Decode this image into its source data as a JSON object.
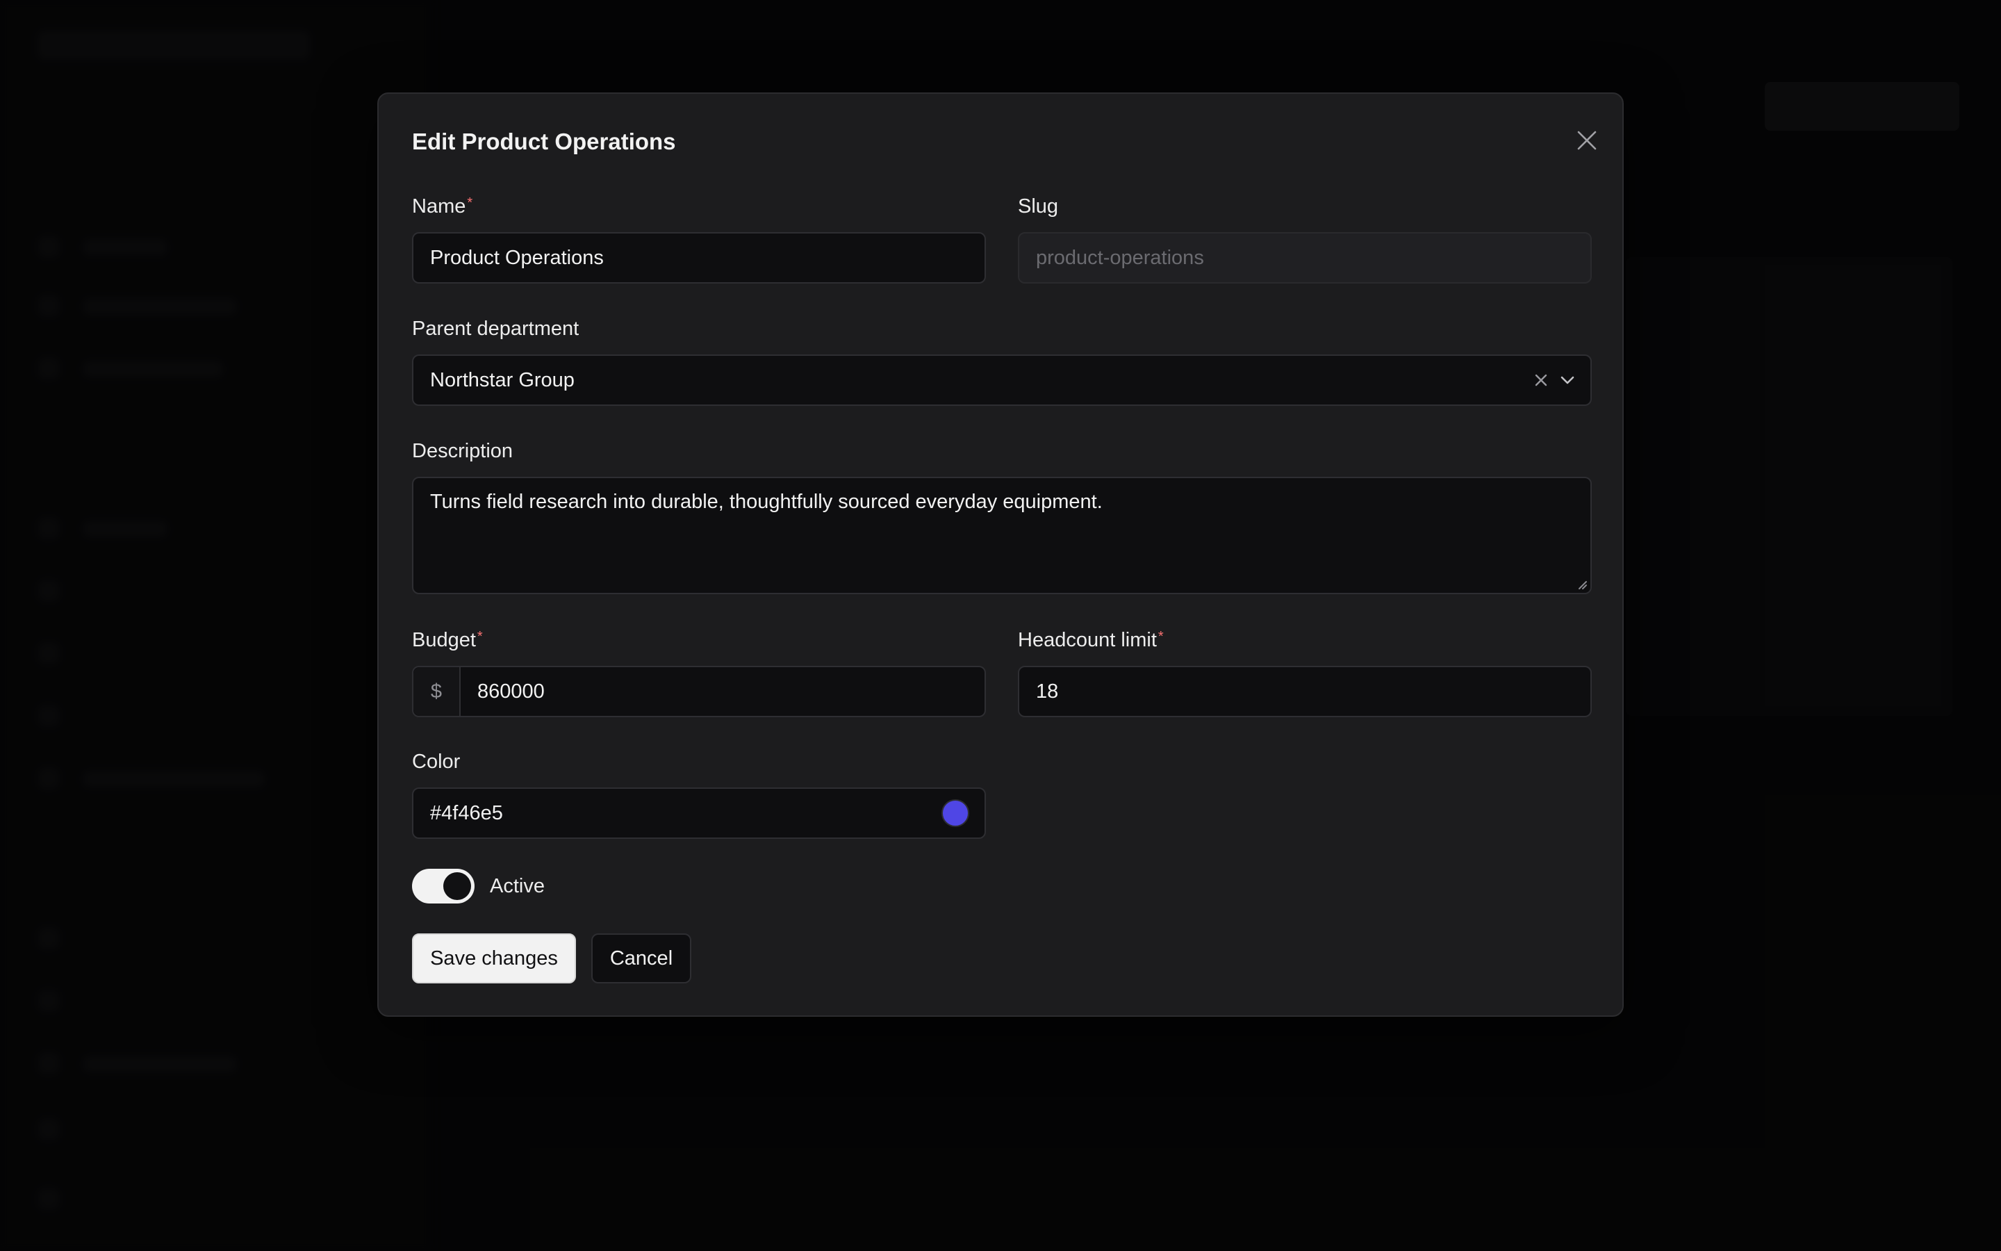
{
  "dialog": {
    "title": "Edit Product Operations",
    "close_icon": "close-icon"
  },
  "form": {
    "name": {
      "label": "Name",
      "required": true,
      "value": "Product Operations"
    },
    "slug": {
      "label": "Slug",
      "placeholder": "product-operations",
      "disabled": true
    },
    "parent_department": {
      "label": "Parent department",
      "value": "Northstar Group",
      "clear_icon": "x-icon",
      "chevron_icon": "chevron-down-icon"
    },
    "description": {
      "label": "Description",
      "value": "Turns field research into durable, thoughtfully sourced everyday equipment."
    },
    "budget": {
      "label": "Budget",
      "required": true,
      "prefix": "$",
      "value": "860000"
    },
    "headcount_limit": {
      "label": "Headcount limit",
      "required": true,
      "value": "18"
    },
    "color": {
      "label": "Color",
      "value": "#4f46e5",
      "swatch_color": "#4f46e5"
    },
    "active": {
      "label": "Active",
      "checked": true
    }
  },
  "actions": {
    "save_label": "Save changes",
    "cancel_label": "Cancel"
  },
  "theme": {
    "modal_bg": "#1c1c1e",
    "input_bg": "#0e0e10",
    "required_color": "#f87171",
    "primary_button_bg": "#f2f2f2"
  }
}
